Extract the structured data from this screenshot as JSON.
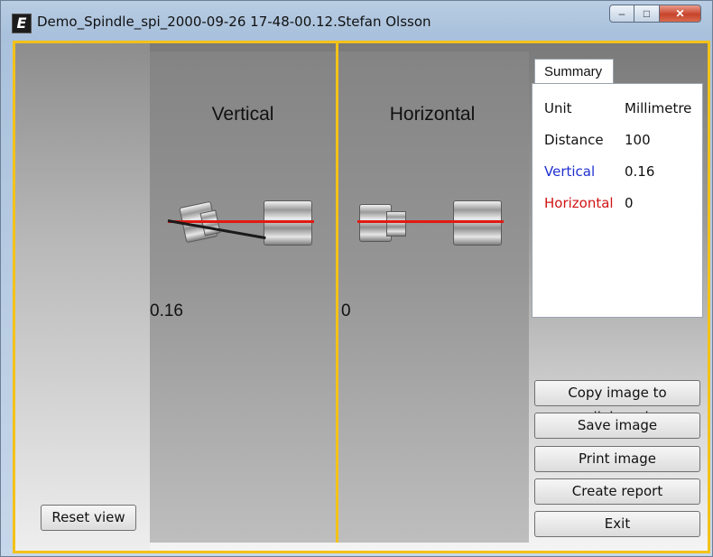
{
  "window": {
    "title": "Demo_Spindle_spi_2000-09-26 17-48-00.12.Stefan Olsson",
    "icon_letter": "E",
    "controls": {
      "minimize": "–",
      "maximize": "□",
      "close": "✕"
    }
  },
  "panels": {
    "vertical": {
      "title": "Vertical",
      "value": "0.16"
    },
    "horizontal": {
      "title": "Horizontal",
      "value": "0"
    }
  },
  "summary": {
    "tab_label": "Summary",
    "rows": [
      {
        "label": "Unit",
        "value": "Millimetre",
        "color": "#111111"
      },
      {
        "label": "Distance",
        "value": "100",
        "color": "#111111"
      },
      {
        "label": "Vertical",
        "value": "0.16",
        "color": "#1f2fd1"
      },
      {
        "label": "Horizontal",
        "value": "0",
        "color": "#d11414"
      }
    ]
  },
  "buttons": {
    "copy": "Copy image to clipboard",
    "save": "Save image",
    "print": "Print image",
    "report": "Create report",
    "exit": "Exit",
    "reset": "Reset view"
  },
  "colors": {
    "accent": "#f3c219",
    "reference_line": "#e11b12",
    "measured_line": "#1a1a1a"
  }
}
